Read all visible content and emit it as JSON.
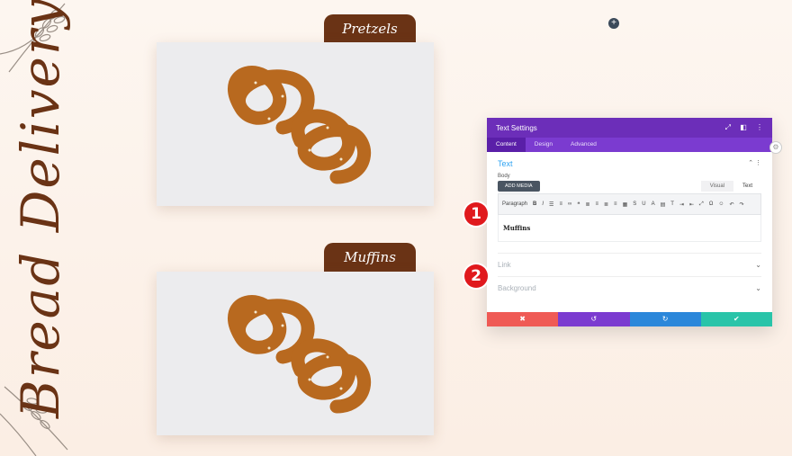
{
  "page": {
    "vertical_title": "Bread Delivery",
    "add_icon": "+"
  },
  "cards": [
    {
      "label": "Pretzels",
      "image": "pretzel-photo"
    },
    {
      "label": "Muffins",
      "image": "pretzel-photo"
    }
  ],
  "settings": {
    "title": "Text Settings",
    "tabs": [
      "Content",
      "Design",
      "Advanced"
    ],
    "section": "Text",
    "body_label": "Body",
    "add_media": "ADD MEDIA",
    "visual_tab": "Visual",
    "text_tab": "Text",
    "format_select": "Paragraph",
    "editor_text": "Muffins",
    "rows": [
      "Link",
      "Background"
    ],
    "actions": {
      "cancel": "✖",
      "undo": "↺",
      "redo": "↻",
      "save": "✔"
    }
  },
  "badges": [
    "1",
    "2"
  ],
  "colors": {
    "brown": "#6a3315",
    "purple": "#6c2eb9",
    "cancel": "#ef5a55",
    "undo": "#7b3bd0",
    "redo": "#2b87da",
    "save": "#29c4a9",
    "badge": "#e0191d"
  }
}
